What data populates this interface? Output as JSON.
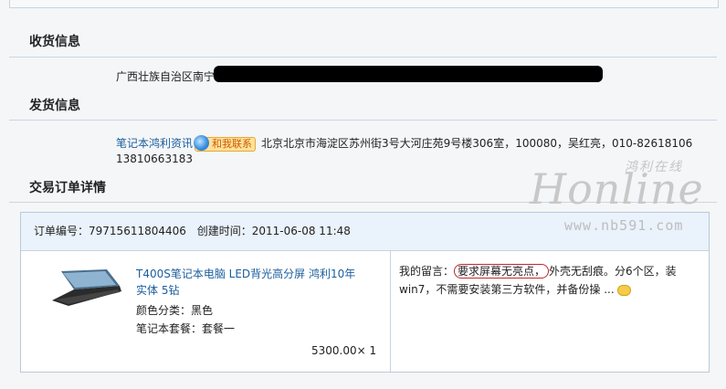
{
  "sections": {
    "receive": {
      "title": "收货信息",
      "address_prefix": "广西壮族自治区南宁"
    },
    "ship": {
      "title": "发货信息",
      "seller": "笔记本鸿利资讯",
      "contact_label": "和我联系",
      "address_line1": "北京北京市海淀区苏州街3号大河庄苑9号楼306室，100080，吴红亮，010-82618106",
      "address_line2": "13810663183"
    },
    "order_detail": {
      "title": "交易订单详情"
    }
  },
  "order": {
    "number_label": "订单编号：",
    "number": "79715611804406",
    "created_label": "创建时间：",
    "created": "2011-06-08 11:48",
    "product": {
      "title": "T400S笔记本电脑 LED背光高分屏 鸿利10年实体 5钻",
      "color_label": "颜色分类：",
      "color": "黑色",
      "bundle_label": "笔记本套餐：",
      "bundle": "套餐一",
      "price": "5300.00",
      "quantity": "× 1"
    },
    "message": {
      "label": "我的留言：",
      "highlighted": "要求屏幕无亮点，",
      "rest": "外壳无刮痕。分6个区，装win7，不需要安装第三方软件，并备份操 ..."
    }
  },
  "watermark": {
    "chinese": "鸿利在线",
    "logo": "Honline",
    "url": "www.nb591.com"
  }
}
